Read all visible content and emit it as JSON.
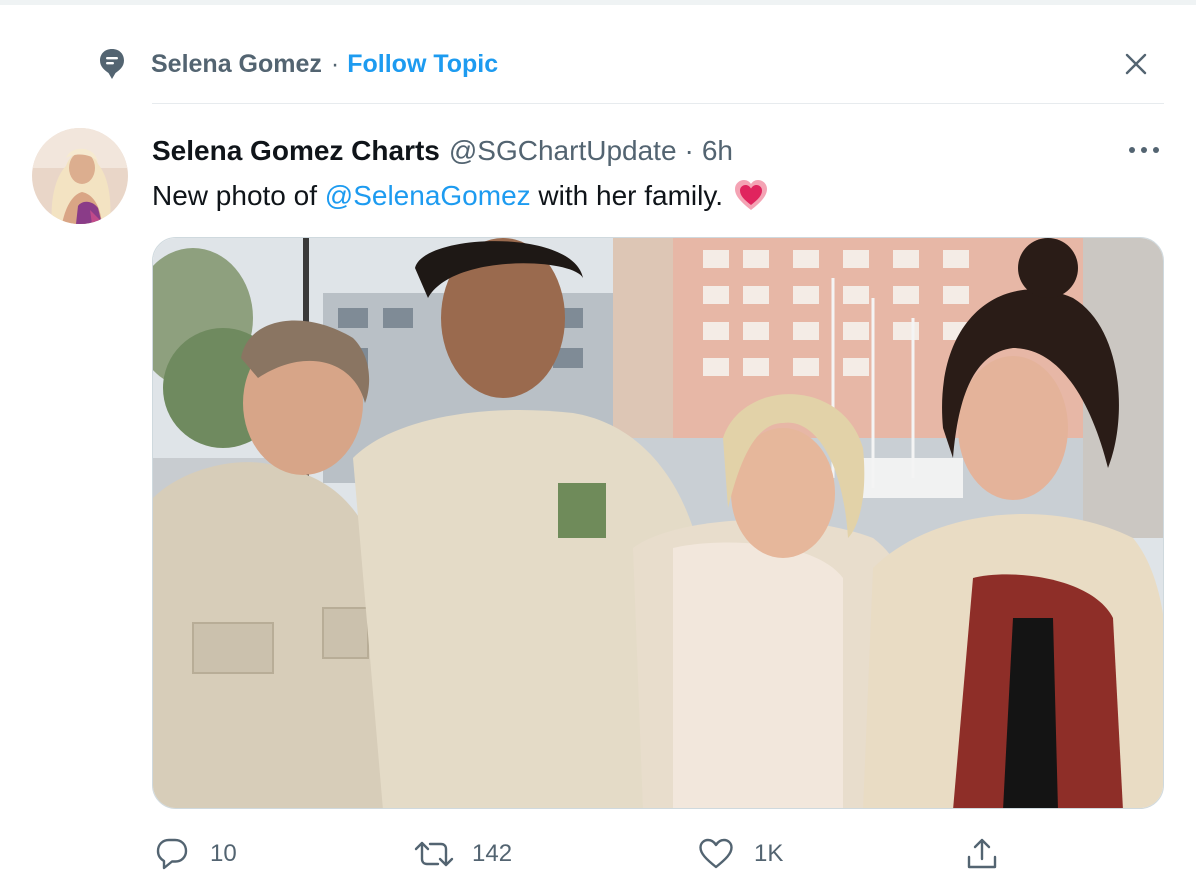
{
  "topic": {
    "name": "Selena Gomez",
    "separator": "·",
    "follow_label": "Follow Topic"
  },
  "tweet": {
    "author_name": "Selena Gomez Charts",
    "handle": "@SGChartUpdate",
    "separator": "·",
    "time": "6h",
    "text_before": "New photo of ",
    "mention": "@SelenaGomez",
    "text_after": " with her family.",
    "emoji": "heart"
  },
  "actions": {
    "reply_count": "10",
    "retweet_count": "142",
    "like_count": "1K"
  },
  "icons": {
    "topic": "topic-icon",
    "close": "close-icon",
    "more": "more-icon",
    "reply": "reply-icon",
    "retweet": "retweet-icon",
    "like": "heart-icon",
    "share": "share-icon"
  },
  "colors": {
    "accent": "#1d9bf0",
    "secondary_text": "#536471",
    "primary_text": "#0f1419",
    "divider": "#e7ebee"
  }
}
